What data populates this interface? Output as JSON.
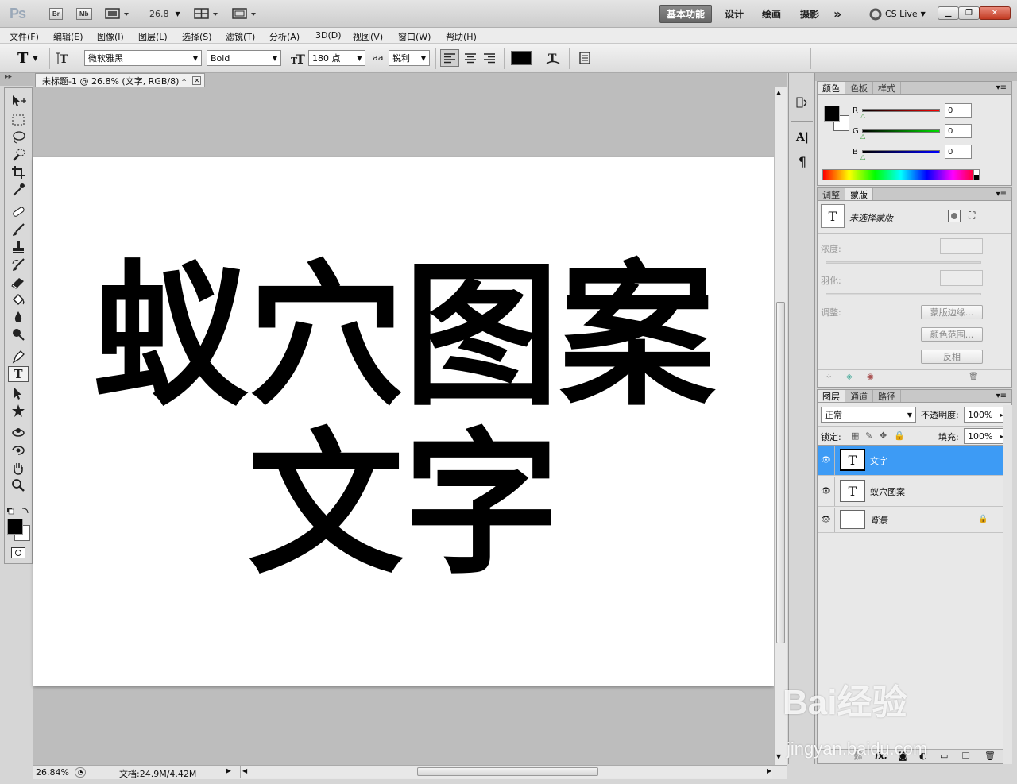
{
  "appbar": {
    "logo": "Ps",
    "br": "Br",
    "mb": "Mb",
    "zoom": "26.8",
    "workspaces": [
      "基本功能",
      "设计",
      "绘画",
      "摄影"
    ],
    "more": "»",
    "cslive": "CS Live"
  },
  "menu": [
    "文件(F)",
    "编辑(E)",
    "图像(I)",
    "图层(L)",
    "选择(S)",
    "滤镜(T)",
    "分析(A)",
    "3D(D)",
    "视图(V)",
    "窗口(W)",
    "帮助(H)"
  ],
  "options": {
    "font_family": "微软雅黑",
    "font_style": "Bold",
    "font_size": "180 点",
    "aa_label": "aa",
    "antialias": "锐利",
    "text_color": "#000000"
  },
  "document": {
    "tab_title": "未标题-1 @ 26.8% (文字, RGB/8) *",
    "line1": "蚁穴图案",
    "line2": "文字",
    "status_zoom": "26.84%",
    "status_doc": "文档:24.9M/4.42M"
  },
  "color_panel": {
    "tabs": [
      "颜色",
      "色板",
      "样式"
    ],
    "r_label": "R",
    "g_label": "G",
    "b_label": "B",
    "r": "0",
    "g": "0",
    "b": "0"
  },
  "mask_panel": {
    "tabs": [
      "调整",
      "蒙版"
    ],
    "title": "未选择蒙版",
    "density": "浓度:",
    "feather": "羽化:",
    "refine": "调整:",
    "btn_edge": "蒙版边缘...",
    "btn_range": "颜色范围...",
    "btn_invert": "反相"
  },
  "layers_panel": {
    "tabs": [
      "图层",
      "通道",
      "路径"
    ],
    "blend": "正常",
    "opacity_label": "不透明度:",
    "opacity": "100%",
    "lock_label": "锁定:",
    "fill_label": "填充:",
    "fill": "100%",
    "layers": [
      {
        "name": "文字",
        "thumb": "T"
      },
      {
        "name": "蚁穴图案",
        "thumb": "T"
      },
      {
        "name": "背景",
        "thumb": ""
      }
    ],
    "footer_fx": "fx."
  },
  "watermark": {
    "brand": "Bai经验",
    "url": "jingyan.baidu.com"
  }
}
